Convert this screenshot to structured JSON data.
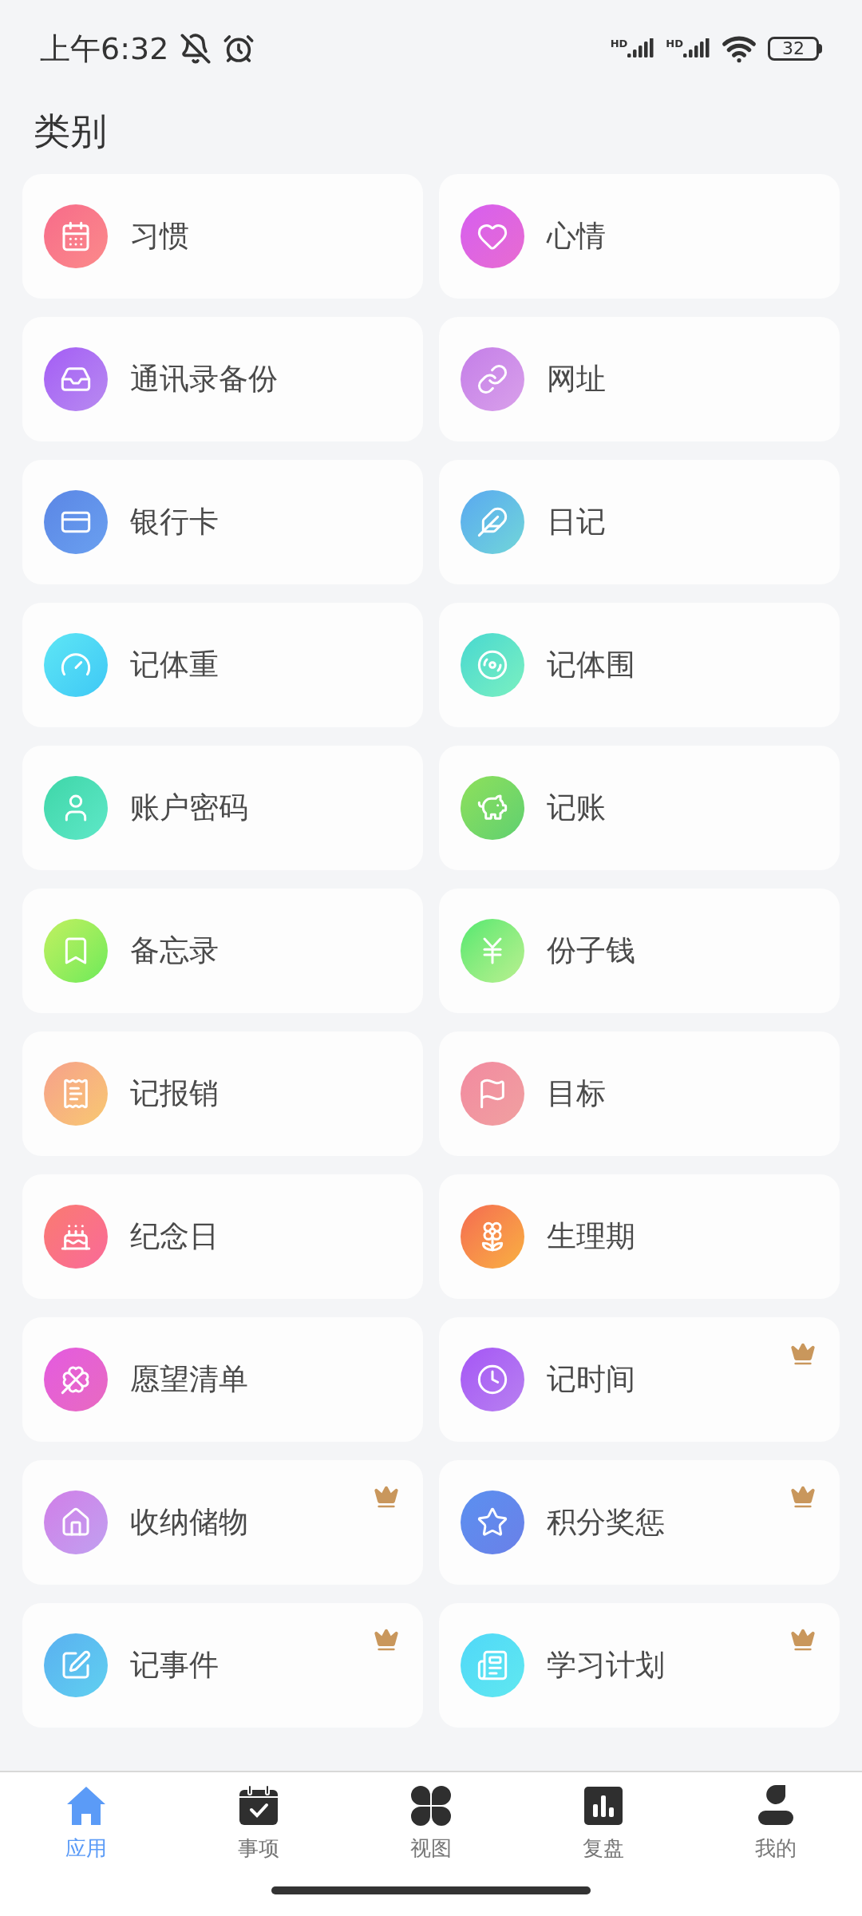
{
  "status_bar": {
    "time": "上午6:32",
    "signals": [
      {
        "label": "HD"
      },
      {
        "label": "HD"
      }
    ],
    "battery": "32"
  },
  "title": "类别",
  "categories": [
    {
      "label": "习惯",
      "premium": false
    },
    {
      "label": "心情",
      "premium": false
    },
    {
      "label": "通讯录备份",
      "premium": false
    },
    {
      "label": "网址",
      "premium": false
    },
    {
      "label": "银行卡",
      "premium": false
    },
    {
      "label": "日记",
      "premium": false
    },
    {
      "label": "记体重",
      "premium": false
    },
    {
      "label": "记体围",
      "premium": false
    },
    {
      "label": "账户密码",
      "premium": false
    },
    {
      "label": "记账",
      "premium": false
    },
    {
      "label": "备忘录",
      "premium": false
    },
    {
      "label": "份子钱",
      "premium": false
    },
    {
      "label": "记报销",
      "premium": false
    },
    {
      "label": "目标",
      "premium": false
    },
    {
      "label": "纪念日",
      "premium": false
    },
    {
      "label": "生理期",
      "premium": false
    },
    {
      "label": "愿望清单",
      "premium": false
    },
    {
      "label": "记时间",
      "premium": true
    },
    {
      "label": "收纳储物",
      "premium": true
    },
    {
      "label": "积分奖惩",
      "premium": true
    },
    {
      "label": "记事件",
      "premium": true
    },
    {
      "label": "学习计划",
      "premium": true
    }
  ],
  "bottom_nav": [
    {
      "label": "应用",
      "selected": true
    },
    {
      "label": "事项",
      "selected": false
    },
    {
      "label": "视图",
      "selected": false
    },
    {
      "label": "复盘",
      "selected": false
    },
    {
      "label": "我的",
      "selected": false
    }
  ]
}
